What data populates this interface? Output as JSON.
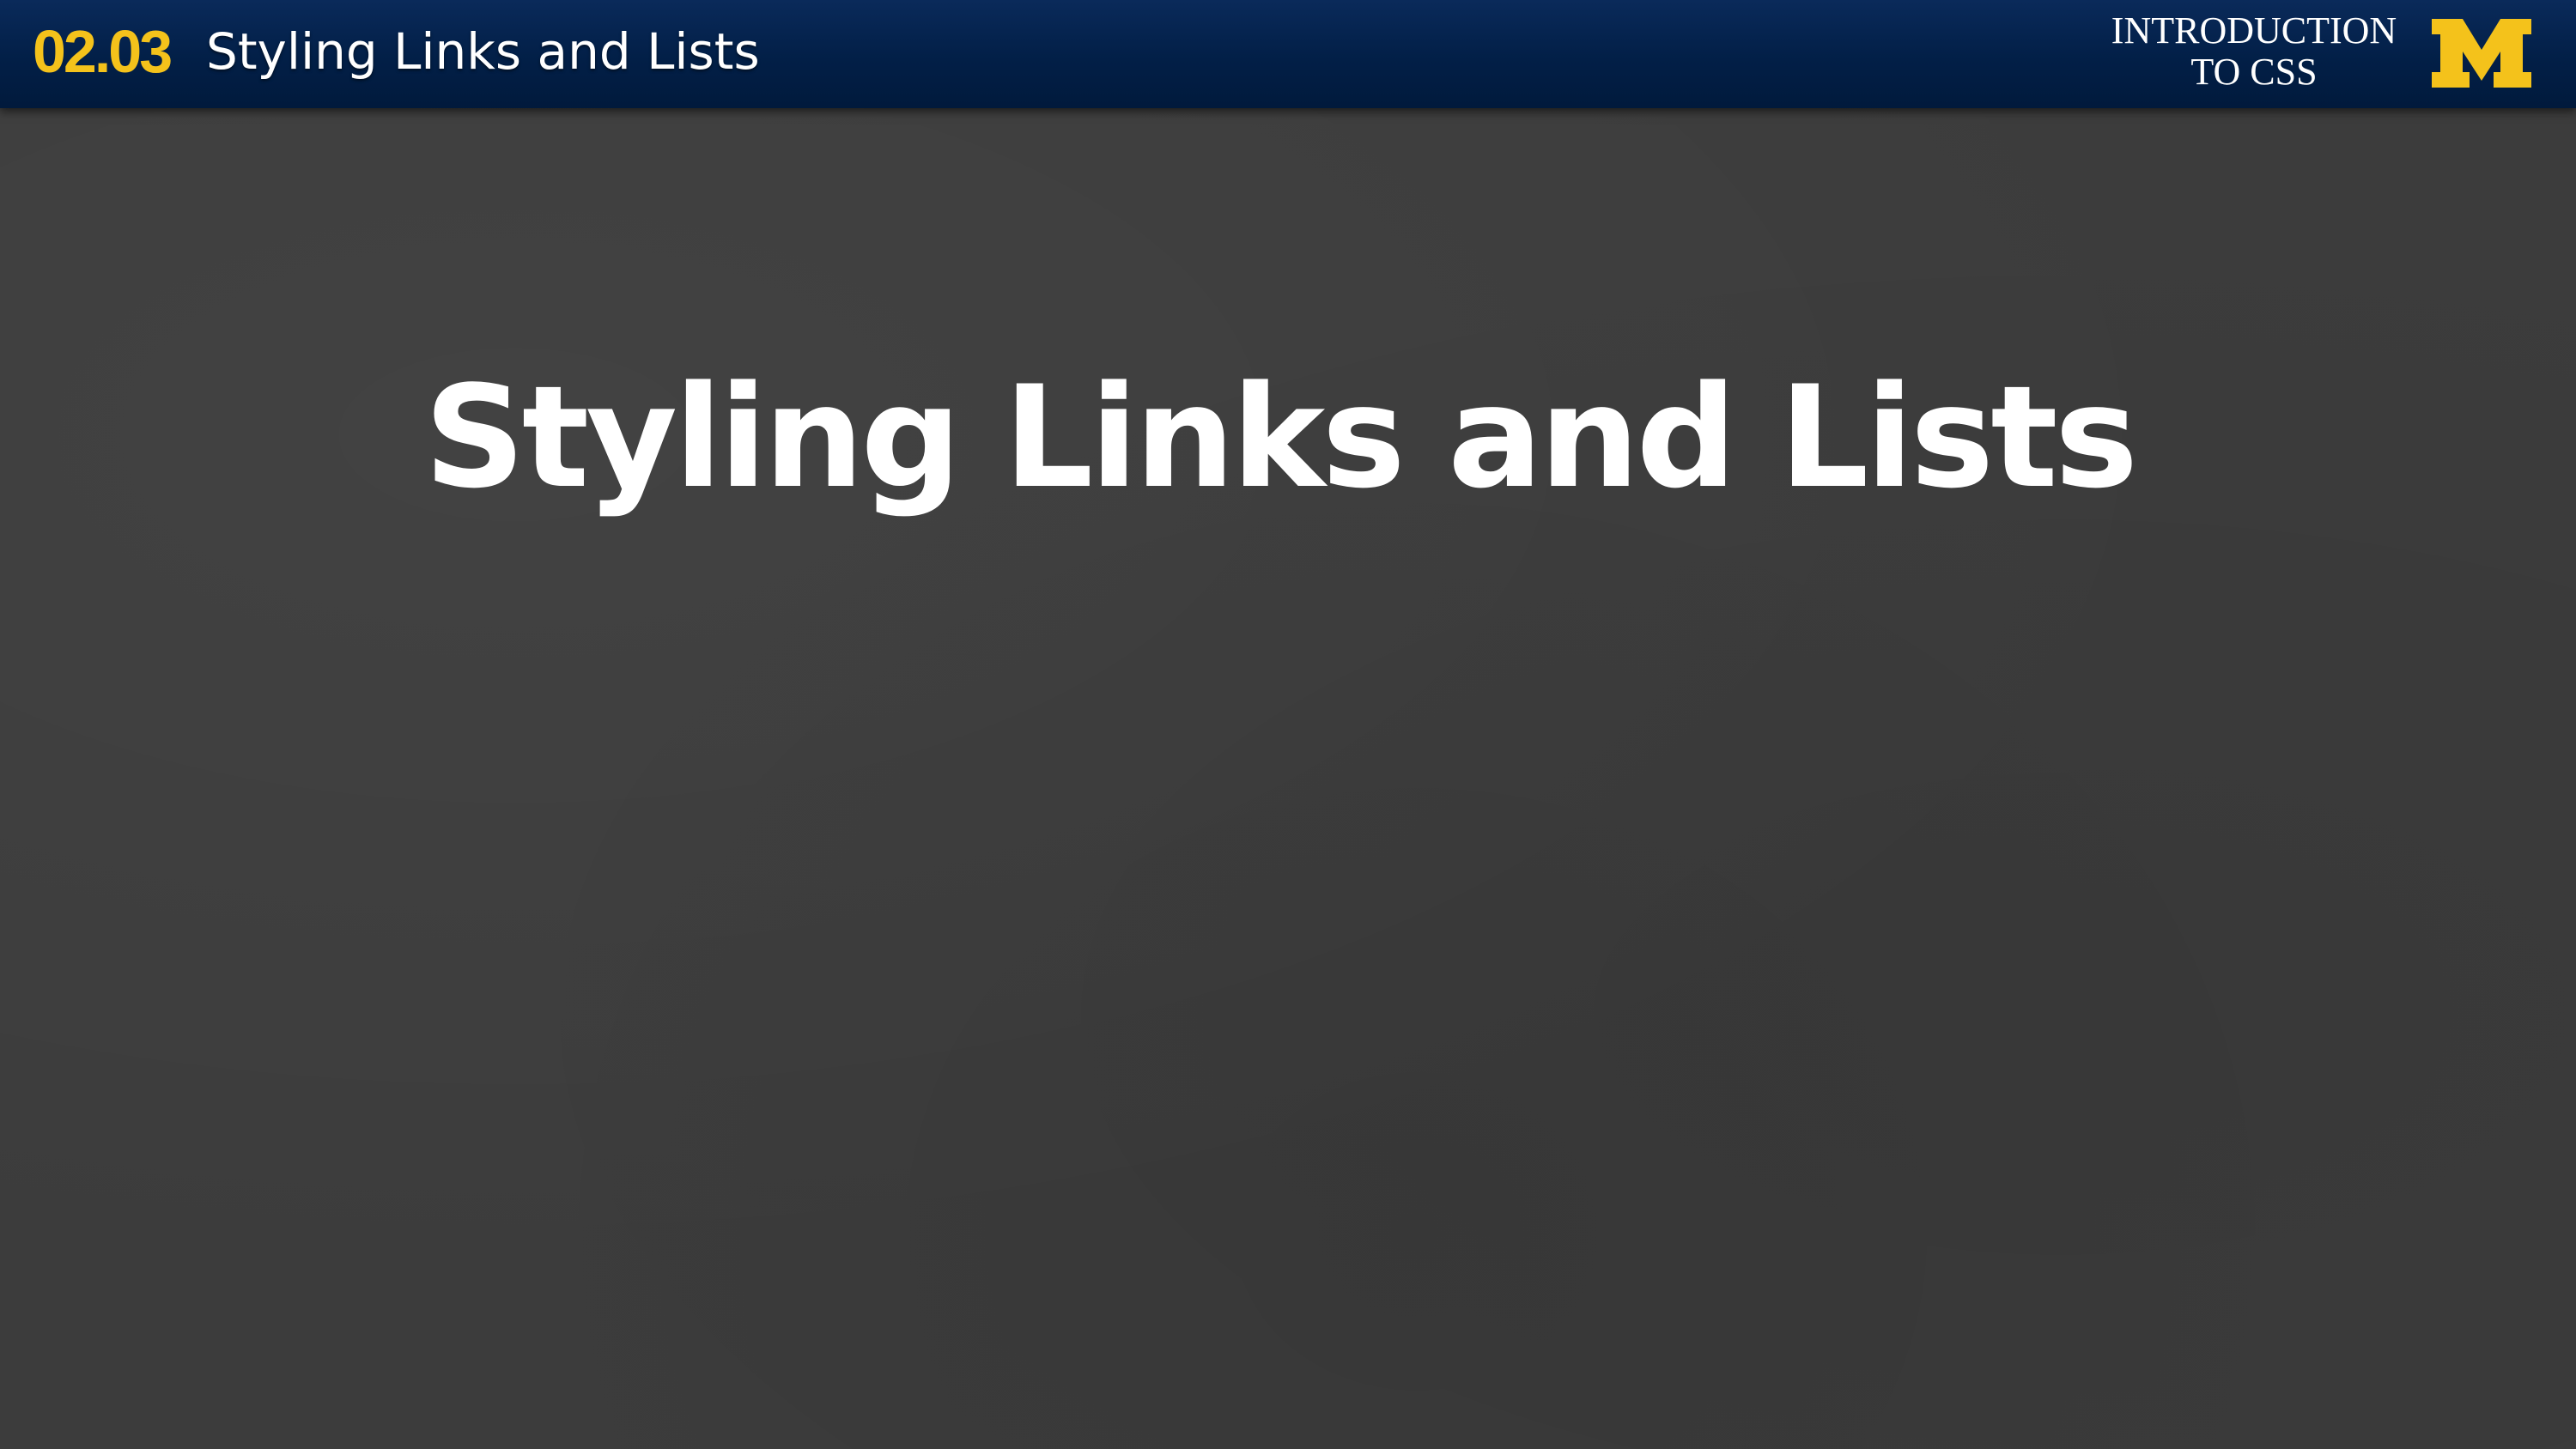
{
  "header": {
    "lesson_number": "02.03",
    "lesson_title": "Styling Links and Lists",
    "course_title_line1": "INTRODUCTION",
    "course_title_line2": "TO CSS",
    "logo_icon": "block-m-logo-icon",
    "colors": {
      "bar": "#021f47",
      "accent": "#f4c21b"
    }
  },
  "slide": {
    "title": "Styling Links and Lists",
    "background_color": "#3c3c3c"
  }
}
